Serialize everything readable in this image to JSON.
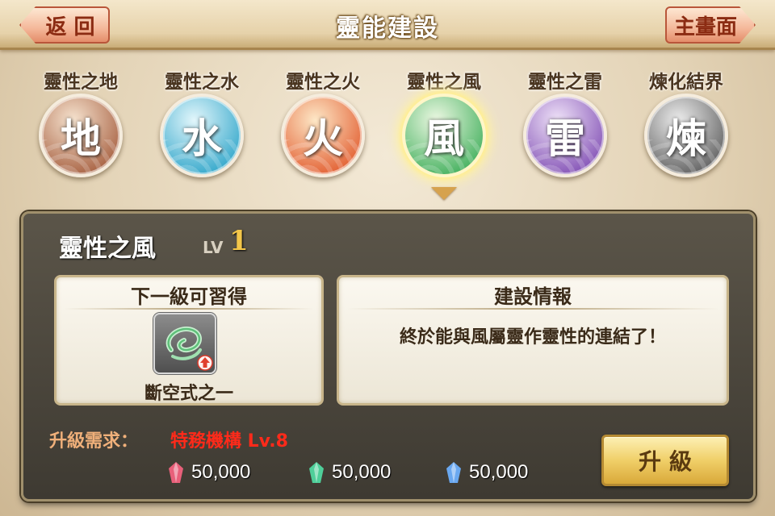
{
  "header": {
    "title": "靈能建設",
    "back_label": "返 回",
    "home_label": "主畫面"
  },
  "tabs": [
    {
      "label": "靈性之地",
      "char": "地",
      "icon": "earth-orb",
      "color_top": "#f6e3cf",
      "color_bottom": "#a35a3a"
    },
    {
      "label": "靈性之水",
      "char": "水",
      "icon": "water-orb",
      "color_top": "#e2f6fb",
      "color_bottom": "#2aa3c8"
    },
    {
      "label": "靈性之火",
      "char": "火",
      "icon": "fire-orb",
      "color_top": "#fde7c6",
      "color_bottom": "#e1582a"
    },
    {
      "label": "靈性之風",
      "char": "風",
      "icon": "wind-orb",
      "color_top": "#ecf8e2",
      "color_bottom": "#3fae5a",
      "selected": true
    },
    {
      "label": "靈性之雷",
      "char": "雷",
      "icon": "thunder-orb",
      "color_top": "#efe2f8",
      "color_bottom": "#7e4bb2"
    },
    {
      "label": "煉化結界",
      "char": "煉",
      "icon": "refine-orb",
      "color_top": "#ececec",
      "color_bottom": "#5a5a5a"
    }
  ],
  "panel": {
    "title": "靈性之風",
    "level_label": "LV",
    "level_value": "1",
    "next_card": {
      "heading": "下一級可習得",
      "skill_icon": "green-swirl-skill-icon",
      "skill_name": "斷空式之一"
    },
    "info_card": {
      "heading": "建設情報",
      "text": "終於能與風屬靈作靈性的連結了！"
    },
    "requirement": {
      "label": "升級需求：",
      "value": "特務機構 Lv.8"
    },
    "costs": [
      {
        "icon": "red-crystal-icon",
        "color": "#e8607a",
        "amount": "50,000"
      },
      {
        "icon": "green-crystal-icon",
        "color": "#4fcf9a",
        "amount": "50,000"
      },
      {
        "icon": "blue-crystal-icon",
        "color": "#6aa8f0",
        "amount": "50,000"
      }
    ],
    "upgrade_label": "升級"
  }
}
